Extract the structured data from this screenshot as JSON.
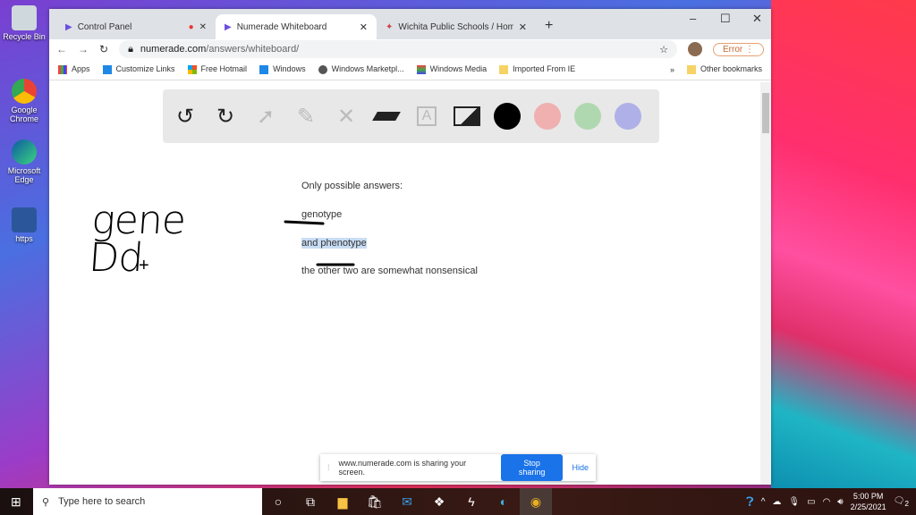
{
  "desktop": {
    "icons": [
      {
        "label": "Recycle Bin"
      },
      {
        "label": "Google Chrome"
      },
      {
        "label": "Microsoft Edge"
      },
      {
        "label": "https"
      }
    ]
  },
  "browser": {
    "tabs": [
      {
        "label": "Control Panel",
        "recording": true
      },
      {
        "label": "Numerade Whiteboard",
        "active": true
      },
      {
        "label": "Wichita Public Schools / Homepa"
      }
    ],
    "url_domain": "numerade.com",
    "url_path": "/answers/whiteboard/",
    "profile_status": "Error",
    "bookmarks": [
      "Apps",
      "Customize Links",
      "Free Hotmail",
      "Windows",
      "Windows Marketpl...",
      "Windows Media",
      "Imported From IE"
    ],
    "other_bookmarks": "Other bookmarks"
  },
  "whiteboard": {
    "tools": [
      "undo-icon",
      "redo-icon",
      "pointer-icon",
      "pen-icon",
      "tools-icon",
      "eraser-icon",
      "text-icon",
      "image-icon"
    ],
    "colors": [
      "#000000",
      "#f0b0b0",
      "#b0d8b0",
      "#b0b0e8"
    ],
    "lines": [
      "Only possible answers:",
      "genotype",
      "and phenotype",
      "the other two are somewhat nonsensical"
    ],
    "handwriting": "gene Dd"
  },
  "share_bar": {
    "message": "www.numerade.com is sharing your screen.",
    "stop": "Stop sharing",
    "hide": "Hide"
  },
  "taskbar": {
    "search_placeholder": "Type here to search",
    "time": "5:00 PM",
    "date": "2/25/2021",
    "notifications": "2"
  }
}
